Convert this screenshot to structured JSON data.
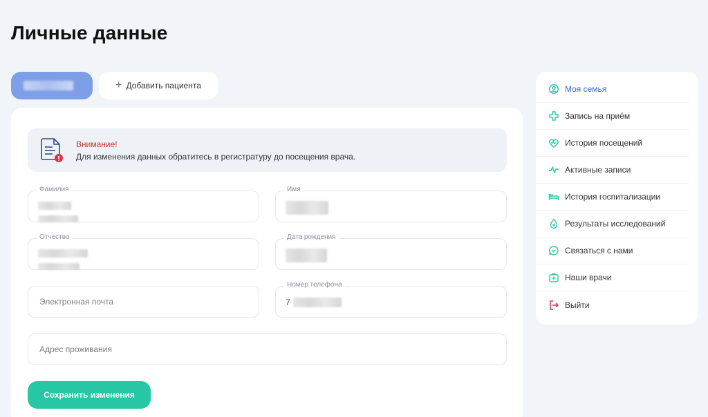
{
  "page": {
    "title": "Личные данные"
  },
  "patients": {
    "add_label": "Добавить пациента"
  },
  "alert": {
    "title": "Внимание!",
    "text": "Для изменения данных обратитесь в регистратуру до посещения врача."
  },
  "form": {
    "surname_label": "Фамилия",
    "name_label": "Имя",
    "patronymic_label": "Отчество",
    "birthdate_label": "Дата рождения",
    "email_placeholder": "Электронная почта",
    "phone_label": "Номер телефона",
    "phone_prefix": "7",
    "address_placeholder": "Адрес проживания",
    "save_label": "Сохранить изменения"
  },
  "menu": {
    "items": [
      {
        "label": "Моя семья",
        "icon": "family-icon",
        "active": true
      },
      {
        "label": "Запись на приём",
        "icon": "medical-cross-icon"
      },
      {
        "label": "История посещений",
        "icon": "heart-pulse-icon"
      },
      {
        "label": "Активные записи",
        "icon": "pulse-line-icon"
      },
      {
        "label": "История госпитализации",
        "icon": "hospital-bed-icon"
      },
      {
        "label": "Результаты исследований",
        "icon": "drop-icon"
      },
      {
        "label": "Связаться с нами",
        "icon": "chat-icon"
      },
      {
        "label": "Наши врачи",
        "icon": "medkit-icon"
      },
      {
        "label": "Выйти",
        "icon": "logout-icon"
      }
    ]
  },
  "colors": {
    "accent_green": "#27c6a5",
    "accent_blue": "#3866d4",
    "patient_tab": "#7e9ee8",
    "alert_red": "#c0392b",
    "menu_icon": "#27c6a5",
    "logout_icon": "#e0304a"
  }
}
